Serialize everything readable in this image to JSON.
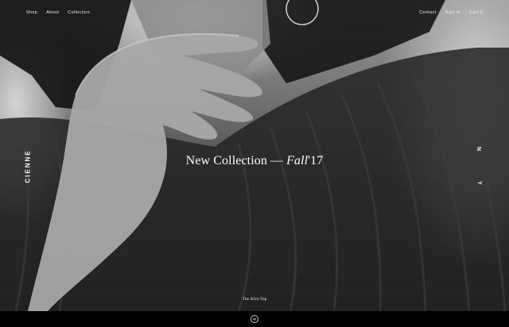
{
  "nav_left": [
    "Shop",
    "About",
    "Collection"
  ],
  "nav_right": [
    "Contact",
    "Sign in",
    "Cart 0"
  ],
  "brand": "CIENNE",
  "side_mark": [
    "N",
    "Y"
  ],
  "headline": {
    "text": "New Collection",
    "separator": "—",
    "season": "Fall",
    "year": "'17"
  },
  "caption": "The Alice Top",
  "icons": {
    "scroll": "chevron-down-circle-icon"
  },
  "colors": {
    "text": "#ffffff",
    "bottom_bar": "#000000"
  }
}
